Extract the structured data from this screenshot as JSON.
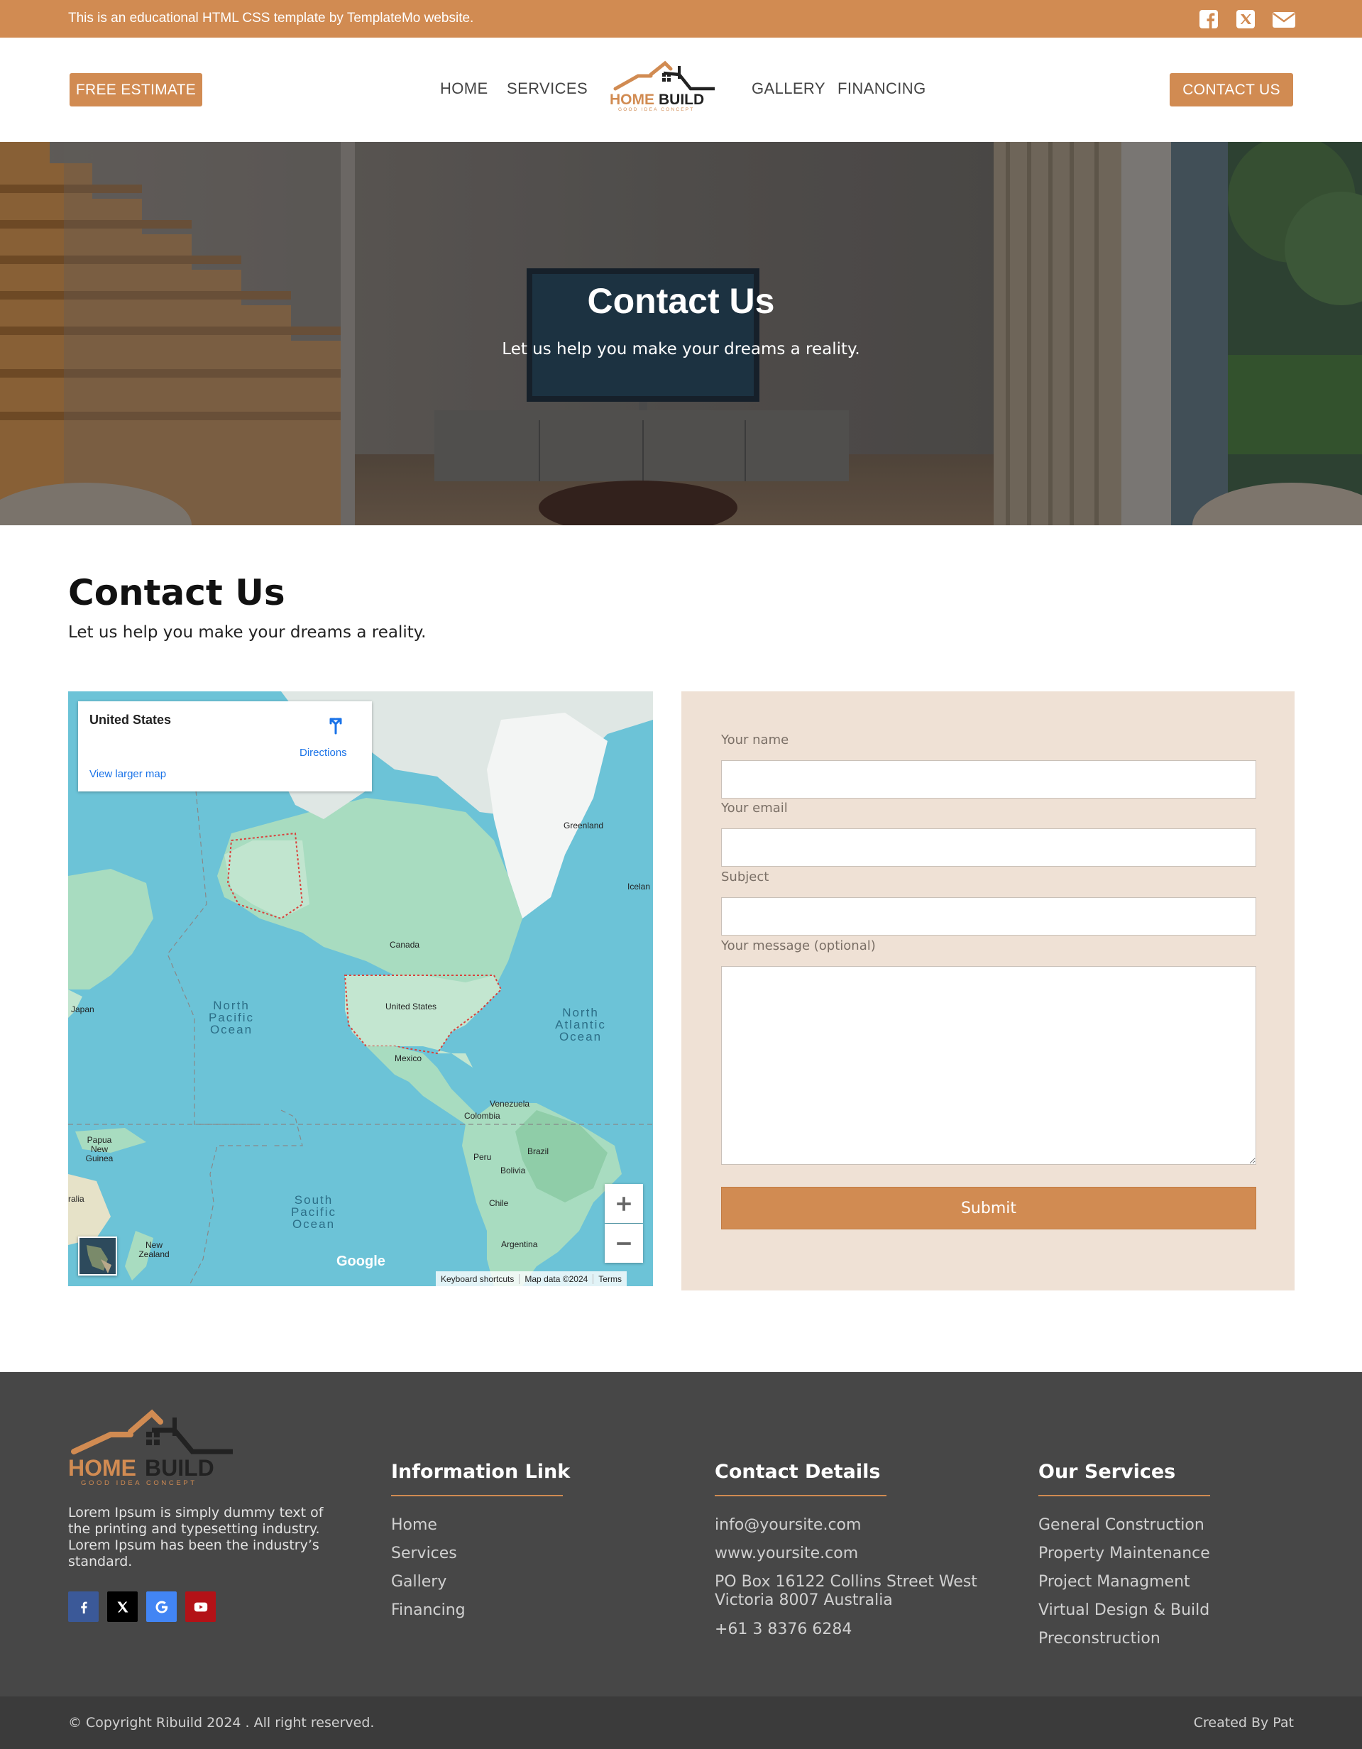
{
  "topbar": {
    "note": "This is an educational HTML CSS template by TemplateMo website.",
    "icons": [
      "facebook-icon",
      "x-icon",
      "envelope-icon"
    ]
  },
  "header": {
    "free_estimate": "FREE ESTIMATE",
    "nav": [
      "HOME",
      "SERVICES",
      "GALLERY",
      "FINANCING"
    ],
    "contact_button": "CONTACT US",
    "logo": {
      "word1": "HOME",
      "word2": "BUILD",
      "tagline": "GOOD IDEA CONCEPT"
    }
  },
  "hero": {
    "title": "Contact Us",
    "subtitle": "Let us help you make your dreams a reality."
  },
  "contact": {
    "title": "Contact Us",
    "subtitle": "Let us help you make your dreams a reality."
  },
  "map": {
    "place": "United States",
    "directions": "Directions",
    "larger_map": "View larger map",
    "labels": {
      "greenland": "Greenland",
      "iceland": "Icelan",
      "canada": "Canada",
      "us": "United States",
      "mexico": "Mexico",
      "japan": "Japan",
      "venezuela": "Venezuela",
      "colombia": "Colombia",
      "brazil": "Brazil",
      "peru": "Peru",
      "bolivia": "Bolivia",
      "chile": "Chile",
      "argentina": "Argentina",
      "png": "Papua New Guinea",
      "nz": "New Zealand",
      "aus": "ralia"
    },
    "oceans": {
      "npac": "North Pacific Ocean",
      "natl": "North Atlantic Ocean",
      "spac": "South Pacific Ocean"
    },
    "google": "Google",
    "attribution": [
      "Keyboard shortcuts",
      "Map data ©2024",
      "Terms"
    ],
    "colors": {
      "water": "#6cc3d7",
      "land": "#a8dcc0",
      "border": "#d9423c"
    }
  },
  "form": {
    "name_label": "Your name",
    "email_label": "Your email",
    "subject_label": "Subject",
    "message_label": "Your message (optional)",
    "submit": "Submit"
  },
  "footer": {
    "about": "Lorem Ipsum is simply dummy text of the printing and typesetting industry. Lorem Ipsum has been the industry’s standard.",
    "social_icons": [
      "facebook-icon",
      "x-icon",
      "google-icon",
      "youtube-icon"
    ],
    "info_title": "Information Link",
    "info_links": [
      "Home",
      "Services",
      "Gallery",
      "Financing"
    ],
    "contact_title": "Contact Details",
    "email": "info@yoursite.com",
    "website": "www.yoursite.com",
    "address_line1": "PO Box 16122 Collins Street West",
    "address_line2": "Victoria 8007 Australia",
    "phone": "+61 3 8376 6284",
    "services_title": "Our Services",
    "services": [
      "General Construction",
      "Property Maintenance",
      "Project Managment",
      "Virtual Design & Build",
      "Preconstruction"
    ],
    "copyright": "© Copyright Ribuild 2024 . All right reserved.",
    "credit": "Created By Pat"
  },
  "colors": {
    "accent": "#d18b52",
    "form_bg": "#efe1d5",
    "footer_bg": "#474747",
    "bottom_bg": "#3b3b3b"
  }
}
